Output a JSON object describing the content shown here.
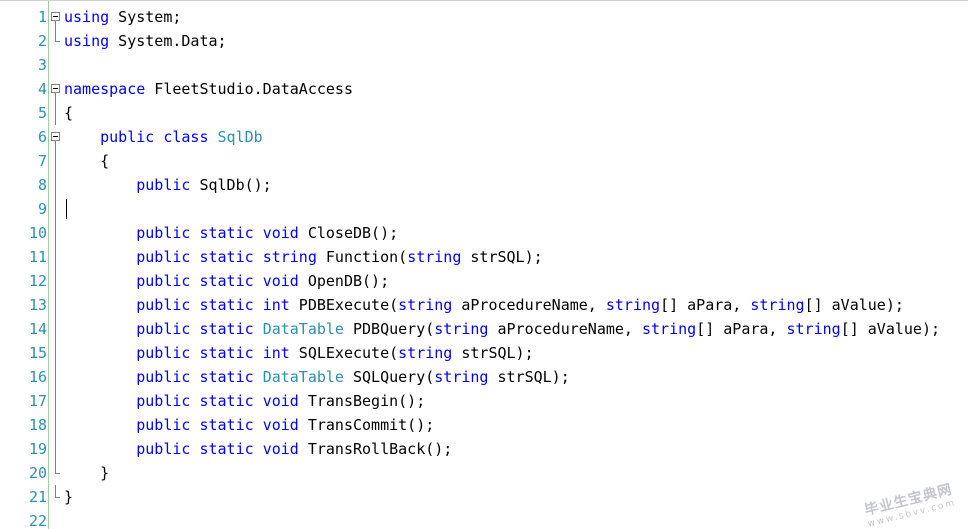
{
  "editor": {
    "lines": [
      {
        "n": "1",
        "fold": "open",
        "tokens": [
          {
            "t": "using",
            "c": "kw"
          },
          {
            "t": " System;",
            "c": ""
          }
        ]
      },
      {
        "n": "2",
        "fold": "end",
        "tokens": [
          {
            "t": "using",
            "c": "kw"
          },
          {
            "t": " System.Data;",
            "c": ""
          }
        ]
      },
      {
        "n": "3",
        "fold": "",
        "tokens": []
      },
      {
        "n": "4",
        "fold": "open",
        "tokens": [
          {
            "t": "namespace",
            "c": "kw"
          },
          {
            "t": " FleetStudio.DataAccess",
            "c": ""
          }
        ]
      },
      {
        "n": "5",
        "fold": "line",
        "tokens": [
          {
            "t": "{",
            "c": ""
          }
        ]
      },
      {
        "n": "6",
        "fold": "open",
        "tokens": [
          {
            "t": "    ",
            "c": ""
          },
          {
            "t": "public",
            "c": "kw"
          },
          {
            "t": " ",
            "c": ""
          },
          {
            "t": "class",
            "c": "kw"
          },
          {
            "t": " ",
            "c": ""
          },
          {
            "t": "SqlDb",
            "c": "ty"
          }
        ]
      },
      {
        "n": "7",
        "fold": "line",
        "tokens": [
          {
            "t": "    {",
            "c": ""
          }
        ]
      },
      {
        "n": "8",
        "fold": "line",
        "tokens": [
          {
            "t": "        ",
            "c": ""
          },
          {
            "t": "public",
            "c": "kw"
          },
          {
            "t": " SqlDb();",
            "c": ""
          }
        ]
      },
      {
        "n": "9",
        "fold": "line",
        "tokens": [],
        "caret": true
      },
      {
        "n": "10",
        "fold": "line",
        "tokens": [
          {
            "t": "        ",
            "c": ""
          },
          {
            "t": "public",
            "c": "kw"
          },
          {
            "t": " ",
            "c": ""
          },
          {
            "t": "static",
            "c": "kw"
          },
          {
            "t": " ",
            "c": ""
          },
          {
            "t": "void",
            "c": "kw"
          },
          {
            "t": " CloseDB();",
            "c": ""
          }
        ]
      },
      {
        "n": "11",
        "fold": "line",
        "tokens": [
          {
            "t": "        ",
            "c": ""
          },
          {
            "t": "public",
            "c": "kw"
          },
          {
            "t": " ",
            "c": ""
          },
          {
            "t": "static",
            "c": "kw"
          },
          {
            "t": " ",
            "c": ""
          },
          {
            "t": "string",
            "c": "kw"
          },
          {
            "t": " Function(",
            "c": ""
          },
          {
            "t": "string",
            "c": "kw"
          },
          {
            "t": " strSQL);",
            "c": ""
          }
        ]
      },
      {
        "n": "12",
        "fold": "line",
        "tokens": [
          {
            "t": "        ",
            "c": ""
          },
          {
            "t": "public",
            "c": "kw"
          },
          {
            "t": " ",
            "c": ""
          },
          {
            "t": "static",
            "c": "kw"
          },
          {
            "t": " ",
            "c": ""
          },
          {
            "t": "void",
            "c": "kw"
          },
          {
            "t": " OpenDB();",
            "c": ""
          }
        ]
      },
      {
        "n": "13",
        "fold": "line",
        "tokens": [
          {
            "t": "        ",
            "c": ""
          },
          {
            "t": "public",
            "c": "kw"
          },
          {
            "t": " ",
            "c": ""
          },
          {
            "t": "static",
            "c": "kw"
          },
          {
            "t": " ",
            "c": ""
          },
          {
            "t": "int",
            "c": "kw"
          },
          {
            "t": " PDBExecute(",
            "c": ""
          },
          {
            "t": "string",
            "c": "kw"
          },
          {
            "t": " aProcedureName, ",
            "c": ""
          },
          {
            "t": "string",
            "c": "kw"
          },
          {
            "t": "[] aPara, ",
            "c": ""
          },
          {
            "t": "string",
            "c": "kw"
          },
          {
            "t": "[] aValue);",
            "c": ""
          }
        ]
      },
      {
        "n": "14",
        "fold": "line",
        "tokens": [
          {
            "t": "        ",
            "c": ""
          },
          {
            "t": "public",
            "c": "kw"
          },
          {
            "t": " ",
            "c": ""
          },
          {
            "t": "static",
            "c": "kw"
          },
          {
            "t": " ",
            "c": ""
          },
          {
            "t": "DataTable",
            "c": "ty"
          },
          {
            "t": " PDBQuery(",
            "c": ""
          },
          {
            "t": "string",
            "c": "kw"
          },
          {
            "t": " aProcedureName, ",
            "c": ""
          },
          {
            "t": "string",
            "c": "kw"
          },
          {
            "t": "[] aPara, ",
            "c": ""
          },
          {
            "t": "string",
            "c": "kw"
          },
          {
            "t": "[] aValue);",
            "c": ""
          }
        ]
      },
      {
        "n": "15",
        "fold": "line",
        "tokens": [
          {
            "t": "        ",
            "c": ""
          },
          {
            "t": "public",
            "c": "kw"
          },
          {
            "t": " ",
            "c": ""
          },
          {
            "t": "static",
            "c": "kw"
          },
          {
            "t": " ",
            "c": ""
          },
          {
            "t": "int",
            "c": "kw"
          },
          {
            "t": " SQLExecute(",
            "c": ""
          },
          {
            "t": "string",
            "c": "kw"
          },
          {
            "t": " strSQL);",
            "c": ""
          }
        ]
      },
      {
        "n": "16",
        "fold": "line",
        "tokens": [
          {
            "t": "        ",
            "c": ""
          },
          {
            "t": "public",
            "c": "kw"
          },
          {
            "t": " ",
            "c": ""
          },
          {
            "t": "static",
            "c": "kw"
          },
          {
            "t": " ",
            "c": ""
          },
          {
            "t": "DataTable",
            "c": "ty"
          },
          {
            "t": " SQLQuery(",
            "c": ""
          },
          {
            "t": "string",
            "c": "kw"
          },
          {
            "t": " strSQL);",
            "c": ""
          }
        ]
      },
      {
        "n": "17",
        "fold": "line",
        "tokens": [
          {
            "t": "        ",
            "c": ""
          },
          {
            "t": "public",
            "c": "kw"
          },
          {
            "t": " ",
            "c": ""
          },
          {
            "t": "static",
            "c": "kw"
          },
          {
            "t": " ",
            "c": ""
          },
          {
            "t": "void",
            "c": "kw"
          },
          {
            "t": " TransBegin();",
            "c": ""
          }
        ]
      },
      {
        "n": "18",
        "fold": "line",
        "tokens": [
          {
            "t": "        ",
            "c": ""
          },
          {
            "t": "public",
            "c": "kw"
          },
          {
            "t": " ",
            "c": ""
          },
          {
            "t": "static",
            "c": "kw"
          },
          {
            "t": " ",
            "c": ""
          },
          {
            "t": "void",
            "c": "kw"
          },
          {
            "t": " TransCommit();",
            "c": ""
          }
        ]
      },
      {
        "n": "19",
        "fold": "line",
        "tokens": [
          {
            "t": "        ",
            "c": ""
          },
          {
            "t": "public",
            "c": "kw"
          },
          {
            "t": " ",
            "c": ""
          },
          {
            "t": "static",
            "c": "kw"
          },
          {
            "t": " ",
            "c": ""
          },
          {
            "t": "void",
            "c": "kw"
          },
          {
            "t": " TransRollBack();",
            "c": ""
          }
        ]
      },
      {
        "n": "20",
        "fold": "end",
        "tokens": [
          {
            "t": "    }",
            "c": ""
          }
        ]
      },
      {
        "n": "21",
        "fold": "end",
        "tokens": [
          {
            "t": "}",
            "c": ""
          }
        ]
      },
      {
        "n": "22",
        "fold": "",
        "tokens": []
      }
    ]
  },
  "watermark": {
    "line1": "毕业生宝典网",
    "line2": "www.sbvv.com"
  },
  "colors": {
    "keyword": "#0000ff",
    "type": "#2b91af",
    "line_number": "#2b91af"
  }
}
